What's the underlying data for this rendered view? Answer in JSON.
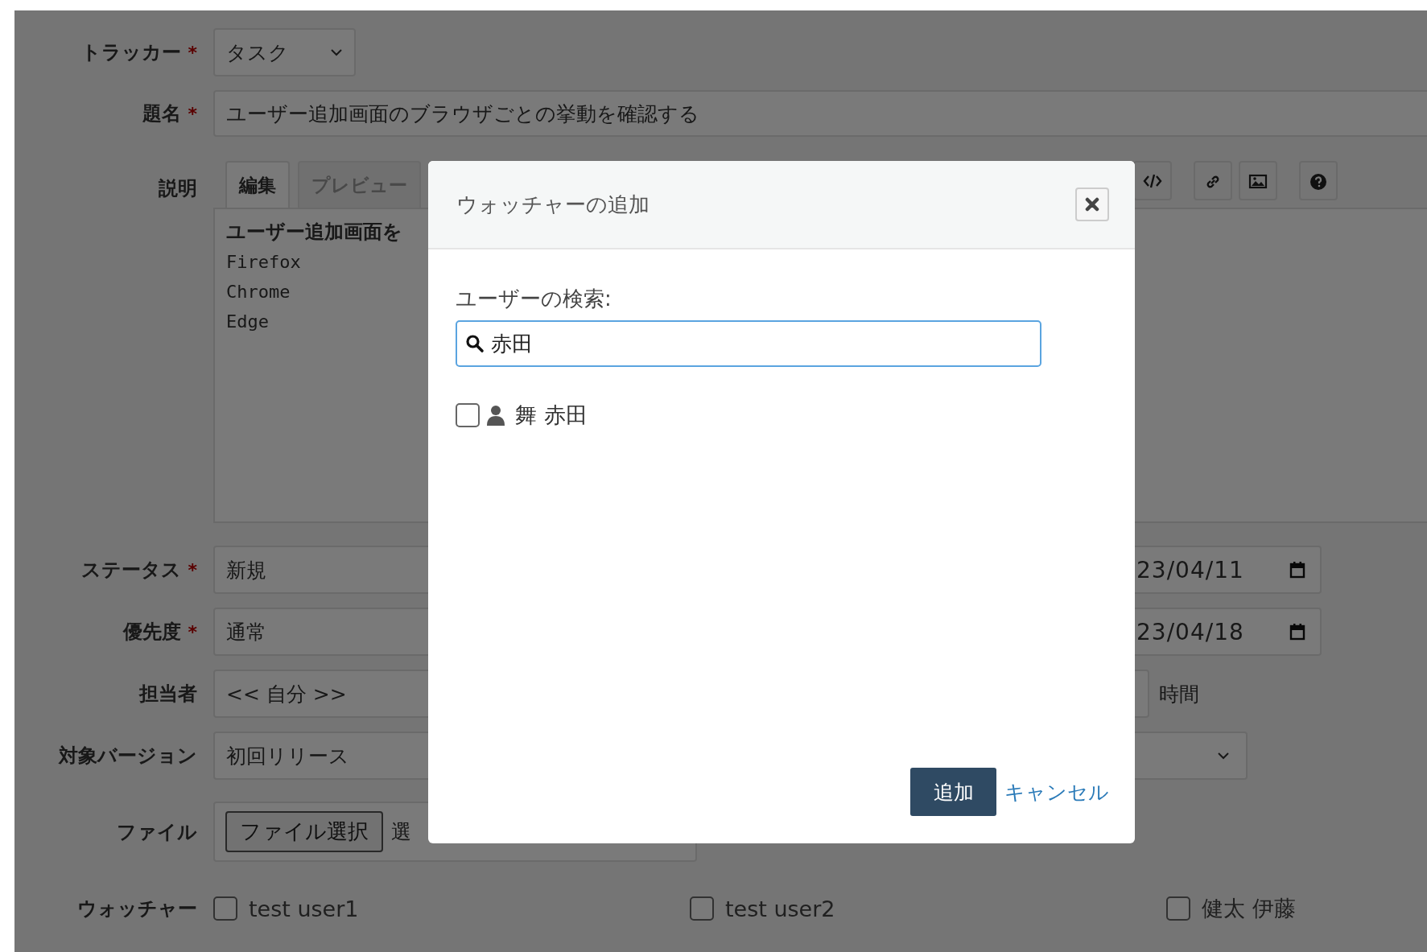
{
  "tracker": {
    "label": "トラッカー",
    "required_mark": "*",
    "value": "タスク"
  },
  "subject": {
    "label": "題名",
    "required_mark": "*",
    "value": "ユーザー追加画面のブラウザごとの挙動を確認する"
  },
  "description": {
    "label": "説明",
    "tabs": [
      {
        "label": "編集",
        "selected": true
      },
      {
        "label": "プレビュー",
        "selected": false
      }
    ],
    "lines": [
      "ユーザー追加画面を",
      "Firefox",
      "Chrome",
      "Edge"
    ]
  },
  "attributes": [
    {
      "label": "ステータス",
      "required_mark": "*",
      "value": "新規",
      "right": {
        "kind": "date",
        "value": "23/04/11"
      }
    },
    {
      "label": "優先度",
      "required_mark": "*",
      "value": "通常",
      "right": {
        "kind": "date",
        "value": "23/04/18"
      }
    },
    {
      "label": "担当者",
      "value": "<< 自分 >>",
      "right": {
        "kind": "hours",
        "unit": "時間"
      }
    },
    {
      "label": "対象バージョン",
      "value": "初回リリース",
      "right": {
        "kind": "select"
      }
    }
  ],
  "file": {
    "label": "ファイル",
    "button": "ファイル選択",
    "status": "選"
  },
  "watchers": {
    "label": "ウォッチャー",
    "users": [
      {
        "name": "test user1",
        "checked": false
      },
      {
        "name": "test user2",
        "checked": false
      },
      {
        "name": "健太 伊藤",
        "checked": false
      }
    ]
  },
  "dialog": {
    "title": "ウォッチャーの追加",
    "search_label": "ユーザーの検索:",
    "search_value": "赤田",
    "results": [
      {
        "name": "舞 赤田",
        "checked": false
      }
    ],
    "submit": "追加",
    "cancel": "キャンセル"
  }
}
